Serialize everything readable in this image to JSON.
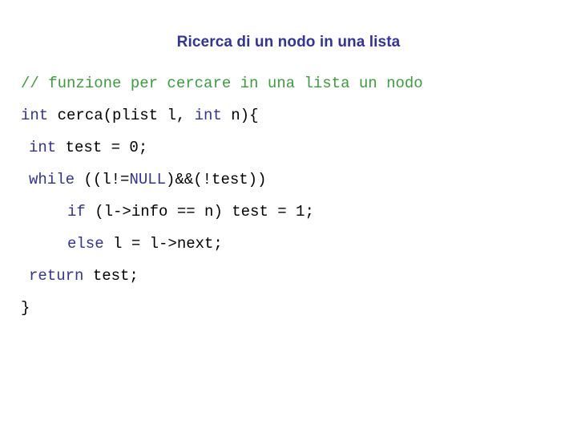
{
  "slide": {
    "title": "Ricerca di un nodo in una lista",
    "background_color": "#ffffff",
    "title_color": "#333399",
    "comment_color": "#3a9e3a",
    "keyword_color": "#333399",
    "plain_color": "#000000"
  },
  "code": {
    "language": "c",
    "lines": [
      {
        "indent": 0,
        "tokens": [
          {
            "text": "// funzione per cercare in una lista un nodo",
            "kind": "comment"
          }
        ]
      },
      {
        "indent": 0,
        "tokens": [
          {
            "text": "int",
            "kind": "keyword"
          },
          {
            "text": " cerca(plist l, ",
            "kind": "plain"
          },
          {
            "text": "int",
            "kind": "keyword"
          },
          {
            "text": " n){",
            "kind": "plain"
          }
        ]
      },
      {
        "indent": 1,
        "tokens": [
          {
            "text": "int",
            "kind": "keyword"
          },
          {
            "text": " test = 0;",
            "kind": "plain"
          }
        ]
      },
      {
        "indent": 1,
        "tokens": [
          {
            "text": "while",
            "kind": "keyword"
          },
          {
            "text": " ((l!=",
            "kind": "plain"
          },
          {
            "text": "NULL",
            "kind": "keyword"
          },
          {
            "text": ")&&(!test))",
            "kind": "plain"
          }
        ]
      },
      {
        "indent": 3,
        "tokens": [
          {
            "text": "if",
            "kind": "keyword"
          },
          {
            "text": " (l->info == n) test = 1;",
            "kind": "plain"
          }
        ]
      },
      {
        "indent": 3,
        "tokens": [
          {
            "text": "else",
            "kind": "keyword"
          },
          {
            "text": " l = l->next;",
            "kind": "plain"
          }
        ]
      },
      {
        "indent": 1,
        "tokens": [
          {
            "text": "return",
            "kind": "keyword"
          },
          {
            "text": " test;",
            "kind": "plain"
          }
        ]
      },
      {
        "indent": 0,
        "tokens": [
          {
            "text": "}",
            "kind": "plain"
          }
        ]
      }
    ]
  }
}
